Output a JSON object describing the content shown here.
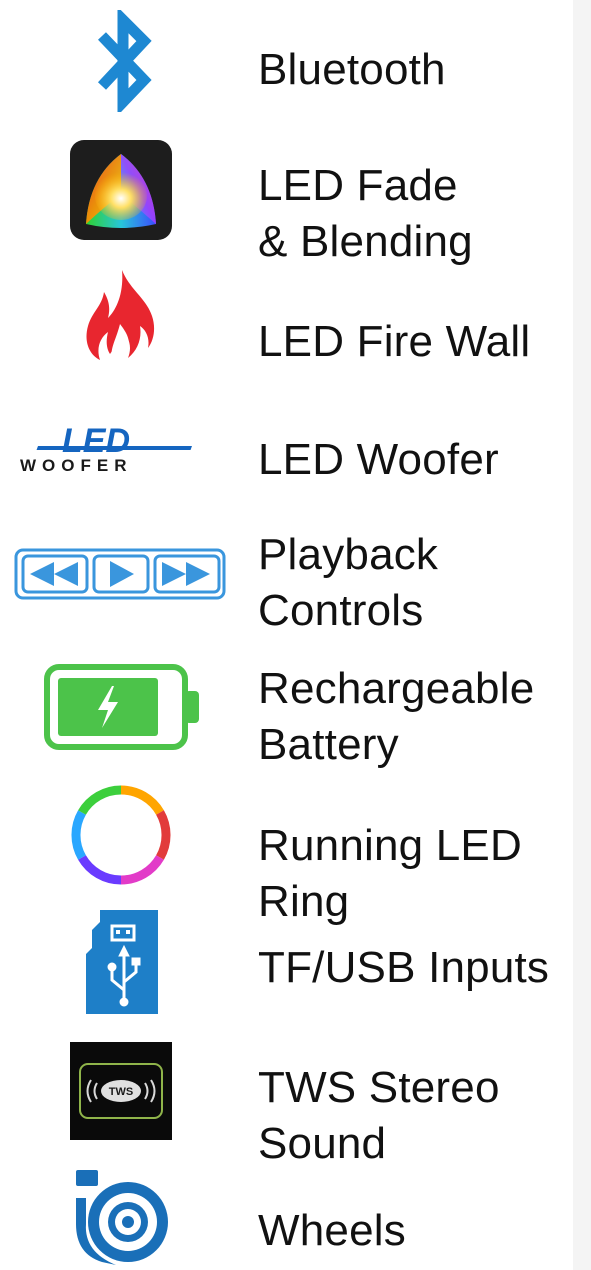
{
  "features": [
    {
      "icon": "bluetooth-icon",
      "lines": [
        "Bluetooth"
      ]
    },
    {
      "icon": "led-fade-icon",
      "lines": [
        "LED Fade",
        "& Blending"
      ]
    },
    {
      "icon": "fire-icon",
      "lines": [
        "LED Fire Wall"
      ]
    },
    {
      "icon": "led-woofer-logo",
      "lines": [
        "LED Woofer"
      ],
      "logo_text": [
        "LED",
        "WOOFER"
      ]
    },
    {
      "icon": "playback-controls-icon",
      "lines": [
        "Playback",
        "Controls"
      ]
    },
    {
      "icon": "battery-icon",
      "lines": [
        "Rechargeable",
        "Battery"
      ]
    },
    {
      "icon": "led-ring-icon",
      "lines": [
        "Running LED",
        "Ring"
      ]
    },
    {
      "icon": "tf-usb-icon",
      "lines": [
        "TF/USB Inputs"
      ]
    },
    {
      "icon": "tws-icon",
      "lines": [
        "TWS Stereo",
        "Sound"
      ],
      "logo_text": "TWS"
    },
    {
      "icon": "wheels-icon",
      "lines": [
        "Wheels"
      ]
    }
  ],
  "colors": {
    "bluetooth": "#1e88d2",
    "fire": "#e8262f",
    "woofer_blue": "#1565c0",
    "playback": "#3a96dd",
    "battery": "#4cc34a",
    "usb": "#1e7fc8",
    "tws_bg": "#0a0a0a",
    "tws_border": "#8fb44a",
    "wheels": "#1a6fb8"
  }
}
